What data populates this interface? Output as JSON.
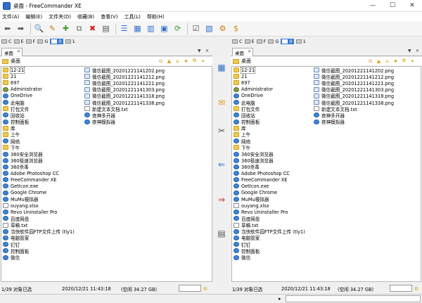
{
  "window": {
    "title": "桌面 - FreeCommander XE",
    "min": "—",
    "max": "☐",
    "close": "✕"
  },
  "menu": [
    "文件(A)",
    "编辑(E)",
    "文件夹(D)",
    "收藏(B)",
    "查看(V)",
    "工具(L)",
    "帮助(H)"
  ],
  "drives": [
    {
      "letter": "C",
      "selected": false
    },
    {
      "letter": "E",
      "selected": false
    },
    {
      "letter": "F",
      "selected": false
    },
    {
      "letter": "G",
      "selected": false
    },
    {
      "letter": "0",
      "selected": true
    },
    {
      "letter": "1",
      "selected": false
    }
  ],
  "left": {
    "tab": "桌面",
    "path": "桌面",
    "col1": [
      {
        "name": "12-21",
        "type": "folder",
        "selected": true
      },
      {
        "name": "21",
        "type": "folder"
      },
      {
        "name": "697",
        "type": "folder"
      },
      {
        "name": "Administrator",
        "type": "user"
      },
      {
        "name": "OneDrive",
        "type": "app"
      },
      {
        "name": "此电脑",
        "type": "app"
      },
      {
        "name": "打包文件",
        "type": "folder"
      },
      {
        "name": "回收站",
        "type": "app"
      },
      {
        "name": "控制面板",
        "type": "app"
      },
      {
        "name": "库",
        "type": "folder"
      },
      {
        "name": "上午",
        "type": "folder"
      },
      {
        "name": "网络",
        "type": "app"
      },
      {
        "name": "下午",
        "type": "folder"
      },
      {
        "name": "360安全浏览器",
        "type": "app"
      },
      {
        "name": "360极速浏览器",
        "type": "app"
      },
      {
        "name": "360杀毒",
        "type": "app"
      },
      {
        "name": "Adobe Photoshop CC",
        "type": "app"
      },
      {
        "name": "FreeCommander XE",
        "type": "app"
      },
      {
        "name": "GetIcon.exe",
        "type": "app"
      },
      {
        "name": "Google Chrome",
        "type": "app"
      },
      {
        "name": "MuMu模拟器",
        "type": "app"
      },
      {
        "name": "ouyang.xlsx",
        "type": "file"
      },
      {
        "name": "Revo Uninstaller Pro",
        "type": "app"
      },
      {
        "name": "百度网盘",
        "type": "app"
      },
      {
        "name": "草稿.txt",
        "type": "file"
      },
      {
        "name": "当快软件园FTP文件上传 (tly1)",
        "type": "app"
      },
      {
        "name": "电脑管家",
        "type": "app"
      },
      {
        "name": "钉钉",
        "type": "app"
      },
      {
        "name": "控制面板",
        "type": "app"
      },
      {
        "name": "微信",
        "type": "app"
      }
    ],
    "col2": [
      {
        "name": "微信截图_20201221141202.png",
        "type": "png"
      },
      {
        "name": "微信截图_20201221141212.png",
        "type": "png"
      },
      {
        "name": "微信截图_20201221141221.png",
        "type": "png"
      },
      {
        "name": "微信截图_20201221141303.png",
        "type": "png"
      },
      {
        "name": "微信截图_20201221141318.png",
        "type": "png"
      },
      {
        "name": "微信截图_20201221141338.png",
        "type": "png"
      },
      {
        "name": "新建文本文档.txt",
        "type": "file"
      },
      {
        "name": "夜神多开器",
        "type": "app"
      },
      {
        "name": "夜神模拟器",
        "type": "app"
      }
    ],
    "status": {
      "count": "1/39 对象已选",
      "datetime": "2020/12/21 11:43:18",
      "free": "(空闲 34.27 GB)"
    }
  },
  "right": {
    "tab": "桌面",
    "path": "桌面",
    "col1": [
      {
        "name": "12-21",
        "type": "folder",
        "selected": true
      },
      {
        "name": "21",
        "type": "folder"
      },
      {
        "name": "697",
        "type": "folder"
      },
      {
        "name": "Administrator",
        "type": "user"
      },
      {
        "name": "OneDrive",
        "type": "app"
      },
      {
        "name": "此电脑",
        "type": "app"
      },
      {
        "name": "打包文件",
        "type": "folder"
      },
      {
        "name": "回收站",
        "type": "app"
      },
      {
        "name": "控制面板",
        "type": "app"
      },
      {
        "name": "库",
        "type": "folder"
      },
      {
        "name": "上午",
        "type": "folder"
      },
      {
        "name": "网络",
        "type": "app"
      },
      {
        "name": "下午",
        "type": "folder"
      },
      {
        "name": "360安全浏览器",
        "type": "app"
      },
      {
        "name": "360极速浏览器",
        "type": "app"
      },
      {
        "name": "360杀毒",
        "type": "app"
      },
      {
        "name": "Adobe Photoshop CC",
        "type": "app"
      },
      {
        "name": "FreeCommander XE",
        "type": "app"
      },
      {
        "name": "GetIcon.exe",
        "type": "app"
      },
      {
        "name": "Google Chrome",
        "type": "app"
      },
      {
        "name": "MuMu模拟器",
        "type": "app"
      },
      {
        "name": "ouyang.xlsx",
        "type": "file"
      },
      {
        "name": "Revo Uninstaller Pro",
        "type": "app"
      },
      {
        "name": "百度网盘",
        "type": "app"
      },
      {
        "name": "草稿.txt",
        "type": "file"
      },
      {
        "name": "当快软件园FTP文件上传 (tly1)",
        "type": "app"
      },
      {
        "name": "电脑管家",
        "type": "app"
      },
      {
        "name": "钉钉",
        "type": "app"
      },
      {
        "name": "控制面板",
        "type": "app"
      },
      {
        "name": "微信",
        "type": "app"
      }
    ],
    "col2": [
      {
        "name": "微信截图_20201221141202.png",
        "type": "png"
      },
      {
        "name": "微信截图_20201221141212.png",
        "type": "png"
      },
      {
        "name": "微信截图_20201221141221.png",
        "type": "png"
      },
      {
        "name": "微信截图_20201221141303.png",
        "type": "png"
      },
      {
        "name": "微信截图_20201221141318.png",
        "type": "png"
      },
      {
        "name": "微信截图_20201221141338.png",
        "type": "png"
      },
      {
        "name": "新建文本文档.txt",
        "type": "file"
      },
      {
        "name": "夜神多开器",
        "type": "app"
      },
      {
        "name": "夜神模拟器",
        "type": "app"
      }
    ],
    "status": {
      "count": "1/39 对象已选",
      "datetime": "2020/12/21 11:43:18",
      "free": "(空闲 34.27 GB)"
    }
  },
  "colors": {
    "accent": "#3a7bd5",
    "folder": "#f2c94c"
  }
}
